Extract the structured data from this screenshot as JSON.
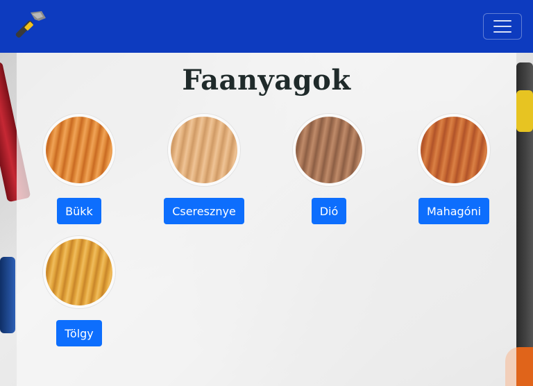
{
  "navbar": {
    "brand_icon": "hammer-icon",
    "toggler_icon": "hamburger-menu-icon",
    "background": "#0d3bbf"
  },
  "page": {
    "title": "Faanyagok"
  },
  "woods": [
    {
      "label": "Bükk",
      "colors": [
        "#e08a3a",
        "#c96a22",
        "#f0a357"
      ]
    },
    {
      "label": "Cseresznye",
      "colors": [
        "#e2b07c",
        "#cf9a66",
        "#efc497"
      ]
    },
    {
      "label": "Dió",
      "colors": [
        "#a87556",
        "#8b5e44",
        "#bf8b6a"
      ]
    },
    {
      "label": "Mahagóni",
      "colors": [
        "#c96a33",
        "#b0532a",
        "#da8146"
      ]
    },
    {
      "label": "Tölgy",
      "colors": [
        "#e2a43b",
        "#c8852a",
        "#f0bd5e"
      ]
    }
  ],
  "accent": "#0d6efd"
}
